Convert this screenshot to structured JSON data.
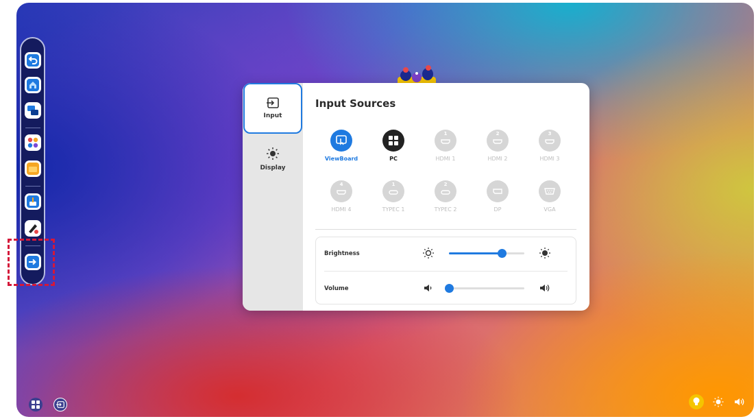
{
  "dialog": {
    "title": "Input Sources",
    "tabs": [
      {
        "label": "Input",
        "icon": "input-icon",
        "active": true
      },
      {
        "label": "Display",
        "icon": "sun-icon",
        "active": false
      }
    ],
    "sources": [
      {
        "label": "ViewBoard",
        "state": "selected",
        "icon": "viewboard-icon",
        "num": ""
      },
      {
        "label": "PC",
        "state": "available",
        "icon": "windows-icon",
        "num": ""
      },
      {
        "label": "HDMI 1",
        "state": "disabled",
        "icon": "hdmi-icon",
        "num": "1"
      },
      {
        "label": "HDMI 2",
        "state": "disabled",
        "icon": "hdmi-icon",
        "num": "2"
      },
      {
        "label": "HDMI 3",
        "state": "disabled",
        "icon": "hdmi-icon",
        "num": "3"
      },
      {
        "label": "HDMI 4",
        "state": "disabled",
        "icon": "hdmi-icon",
        "num": "4"
      },
      {
        "label": "TYPEC 1",
        "state": "disabled",
        "icon": "typec-icon",
        "num": "1"
      },
      {
        "label": "TYPEC 2",
        "state": "disabled",
        "icon": "typec-icon",
        "num": "2"
      },
      {
        "label": "DP",
        "state": "disabled",
        "icon": "displayport-icon",
        "num": ""
      },
      {
        "label": "VGA",
        "state": "disabled",
        "icon": "vga-icon",
        "num": ""
      }
    ],
    "brightness": {
      "label": "Brightness",
      "value_fraction": 0.7
    },
    "volume": {
      "label": "Volume",
      "value_fraction": 0.0
    }
  },
  "sidebar": {
    "items": [
      {
        "name": "back-icon",
        "color": "#1f7ae0"
      },
      {
        "name": "home-icon",
        "color": "#1f7ae0"
      },
      {
        "name": "multi-window-icon",
        "color": "#1f7ae0"
      },
      {
        "name": "apps-icon",
        "color": "#e8484a"
      },
      {
        "name": "folder-icon",
        "color": "#f5a623"
      },
      {
        "name": "toolbox-icon",
        "color": "#1f7ae0"
      },
      {
        "name": "pen-icon",
        "color": "#222222"
      },
      {
        "name": "input-source-icon",
        "color": "#1f7ae0"
      }
    ]
  },
  "colors": {
    "accent": "#1f7ae0",
    "sidebar_bg": "#141b5e",
    "highlight": "#d4183a"
  }
}
